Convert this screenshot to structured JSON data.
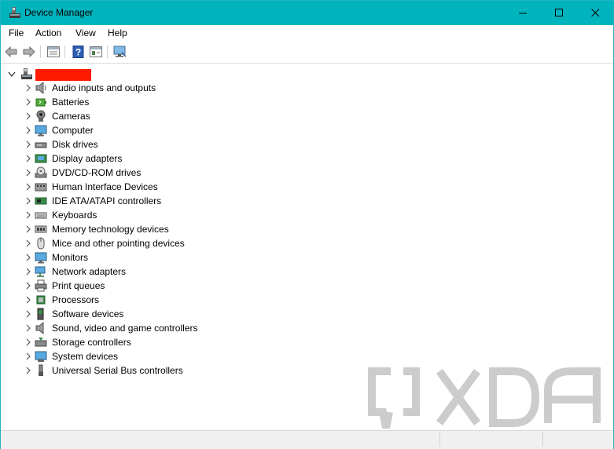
{
  "window": {
    "title": "Device Manager",
    "accent_color": "#00b4be",
    "controls": [
      "minimize-icon",
      "maximize-icon",
      "close-icon"
    ]
  },
  "menubar": {
    "items": [
      {
        "label": "File"
      },
      {
        "label": "Action"
      },
      {
        "label": "View"
      },
      {
        "label": "Help"
      }
    ]
  },
  "toolbar": {
    "buttons": [
      "back-arrow-icon",
      "forward-arrow-icon",
      "properties-icon",
      "help-icon",
      "show-hidden-icon",
      "scan-hardware-icon"
    ]
  },
  "tree": {
    "root": {
      "label": "",
      "redacted": true,
      "icon": "computer-icon"
    },
    "categories": [
      {
        "label": "Audio inputs and outputs",
        "icon": "speaker-icon"
      },
      {
        "label": "Batteries",
        "icon": "battery-icon"
      },
      {
        "label": "Cameras",
        "icon": "camera-icon"
      },
      {
        "label": "Computer",
        "icon": "monitor-icon"
      },
      {
        "label": "Disk drives",
        "icon": "disk-drive-icon"
      },
      {
        "label": "Display adapters",
        "icon": "display-adapter-icon"
      },
      {
        "label": "DVD/CD-ROM drives",
        "icon": "dvd-icon"
      },
      {
        "label": "Human Interface Devices",
        "icon": "hid-icon"
      },
      {
        "label": "IDE ATA/ATAPI controllers",
        "icon": "ide-controller-icon"
      },
      {
        "label": "Keyboards",
        "icon": "keyboard-icon"
      },
      {
        "label": "Memory technology devices",
        "icon": "memory-icon"
      },
      {
        "label": "Mice and other pointing devices",
        "icon": "mouse-icon"
      },
      {
        "label": "Monitors",
        "icon": "monitor-icon"
      },
      {
        "label": "Network adapters",
        "icon": "network-adapter-icon"
      },
      {
        "label": "Print queues",
        "icon": "printer-icon"
      },
      {
        "label": "Processors",
        "icon": "processor-icon"
      },
      {
        "label": "Software devices",
        "icon": "software-device-icon"
      },
      {
        "label": "Sound, video and game controllers",
        "icon": "sound-icon"
      },
      {
        "label": "Storage controllers",
        "icon": "storage-controller-icon"
      },
      {
        "label": "System devices",
        "icon": "system-device-icon"
      },
      {
        "label": "Universal Serial Bus controllers",
        "icon": "usb-icon"
      }
    ]
  },
  "watermark": {
    "icon": "xda-logo"
  }
}
